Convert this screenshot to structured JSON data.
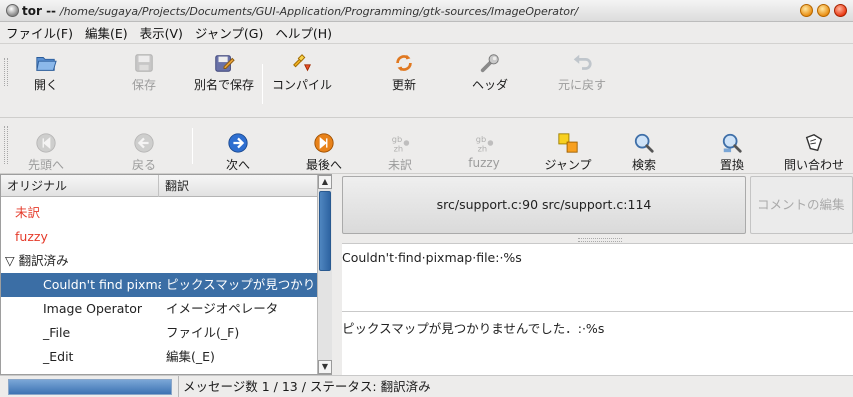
{
  "window": {
    "title_prefix": "tor --",
    "title_path": "/home/sugaya/Projects/Documents/GUI-Application/Programming/gtk-sources/ImageOperator/"
  },
  "menubar": {
    "items": [
      {
        "label": "ファイル(F)"
      },
      {
        "label": "編集(E)"
      },
      {
        "label": "表示(V)"
      },
      {
        "label": "ジャンプ(G)"
      },
      {
        "label": "ヘルプ(H)"
      }
    ]
  },
  "toolbar1": {
    "buttons": [
      {
        "label": "開く",
        "icon": "open-folder-icon",
        "enabled": true
      },
      {
        "label": "保存",
        "icon": "save-icon",
        "enabled": false
      },
      {
        "label": "別名で保存",
        "icon": "save-as-icon",
        "enabled": true
      },
      {
        "label": "コンパイル",
        "icon": "compile-icon",
        "enabled": true
      },
      {
        "label": "更新",
        "icon": "update-icon",
        "enabled": true
      },
      {
        "label": "ヘッダ",
        "icon": "header-wrench-icon",
        "enabled": true
      },
      {
        "label": "元に戻す",
        "icon": "undo-icon",
        "enabled": false
      }
    ]
  },
  "toolbar2": {
    "buttons": [
      {
        "label": "先頭へ",
        "icon": "first-icon",
        "enabled": false
      },
      {
        "label": "戻る",
        "icon": "back-icon",
        "enabled": false
      },
      {
        "label": "次へ",
        "icon": "next-icon",
        "enabled": true
      },
      {
        "label": "最後へ",
        "icon": "last-icon",
        "enabled": true
      },
      {
        "label": "未訳",
        "icon": "untranslated-icon",
        "enabled": false
      },
      {
        "label": "fuzzy",
        "icon": "fuzzy-icon",
        "enabled": false
      },
      {
        "label": "ジャンプ",
        "icon": "jump-icon",
        "enabled": true
      },
      {
        "label": "検索",
        "icon": "search-icon",
        "enabled": true
      },
      {
        "label": "置換",
        "icon": "replace-icon",
        "enabled": true
      },
      {
        "label": "問い合わせ",
        "icon": "query-icon",
        "enabled": true
      }
    ]
  },
  "tree": {
    "columns": [
      "オリジナル",
      "翻訳"
    ],
    "rows": [
      {
        "original": "未訳",
        "translation": "",
        "style": "red"
      },
      {
        "original": "fuzzy",
        "translation": "",
        "style": "red"
      },
      {
        "original": "▽ 翻訳済み",
        "translation": "",
        "style": "group"
      },
      {
        "original": "Couldn't find pixmap file: %s",
        "translation": "ピックスマップが見つかりませんでした",
        "style": "selected"
      },
      {
        "original": "Image Operator",
        "translation": "イメージオペレータ",
        "style": "normal"
      },
      {
        "original": "_File",
        "translation": "ファイル(_F)",
        "style": "normal"
      },
      {
        "original": "_Edit",
        "translation": "編集(_E)",
        "style": "normal"
      }
    ]
  },
  "reference": {
    "text": "src/support.c:90 src/support.c:114"
  },
  "comment_button": {
    "label": "コメントの編集"
  },
  "msgid": {
    "text": "Couldn't·find·pixmap·file:·%s"
  },
  "msgstr": {
    "text": "ピックスマップが見つかりませんでした．:·%s"
  },
  "statusbar": {
    "progress": 1.0,
    "text": "メッセージ数 1 / 13 / ステータス: 翻訳済み"
  },
  "colors": {
    "selection": "#3b6ea5",
    "untranslated_red": "#e53a2a",
    "window_bg": "#edeceb"
  }
}
